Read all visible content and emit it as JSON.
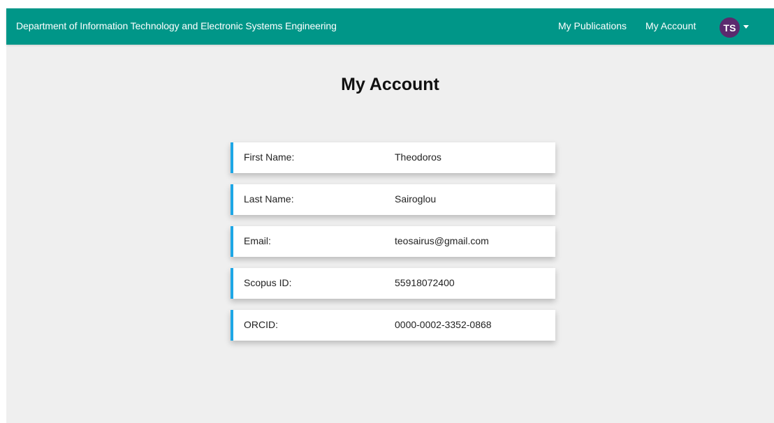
{
  "navbar": {
    "brand": "Department of Information Technology and Electronic Systems Engineering",
    "links": [
      {
        "label": "My Publications"
      },
      {
        "label": "My Account"
      }
    ],
    "avatar_initials": "TS",
    "dropdown_icon": "caret-down-icon"
  },
  "main": {
    "title": "My Account",
    "fields": [
      {
        "label": "First Name:",
        "value": "Theodoros"
      },
      {
        "label": "Last Name:",
        "value": "Sairoglou"
      },
      {
        "label": "Email:",
        "value": "teosairus@gmail.com"
      },
      {
        "label": "Scopus ID:",
        "value": "55918072400"
      },
      {
        "label": "ORCID:",
        "value": "0000-0002-3352-0868"
      }
    ]
  },
  "colors": {
    "navbar_bg": "#009688",
    "avatar_bg": "#5b2a6e",
    "row_accent": "#1ea7e6",
    "page_bg": "#efefef"
  }
}
